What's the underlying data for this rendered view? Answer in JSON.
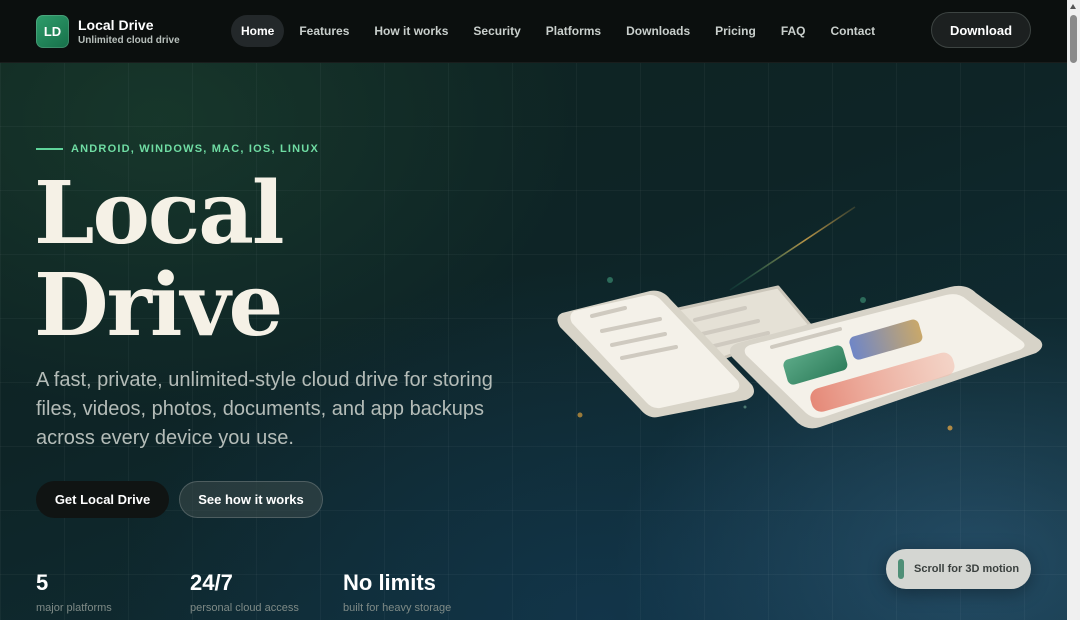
{
  "header": {
    "logo_initials": "LD",
    "brand_name": "Local Drive",
    "brand_tagline": "Unlimited cloud drive",
    "nav": [
      "Home",
      "Features",
      "How it works",
      "Security",
      "Platforms",
      "Downloads",
      "Pricing",
      "FAQ",
      "Contact"
    ],
    "active_nav": "Home",
    "download_label": "Download"
  },
  "hero": {
    "eyebrow": "ANDROID, WINDOWS, MAC, IOS, LINUX",
    "title_line1": "Local",
    "title_line2": "Drive",
    "description": "A fast, private, unlimited-style cloud drive for storing files, videos, photos, documents, and app backups across every device you use.",
    "primary_cta": "Get Local Drive",
    "secondary_cta": "See how it works"
  },
  "stats": [
    {
      "value": "5",
      "label": "major platforms"
    },
    {
      "value": "24/7",
      "label": "personal cloud access"
    },
    {
      "value": "No limits",
      "label": "built for heavy storage"
    }
  ],
  "scroll_hint": "Scroll for 3D motion",
  "colors": {
    "accent": "#6fdca3",
    "brand_green": "#2e9d6b",
    "background": "#0e2426"
  }
}
